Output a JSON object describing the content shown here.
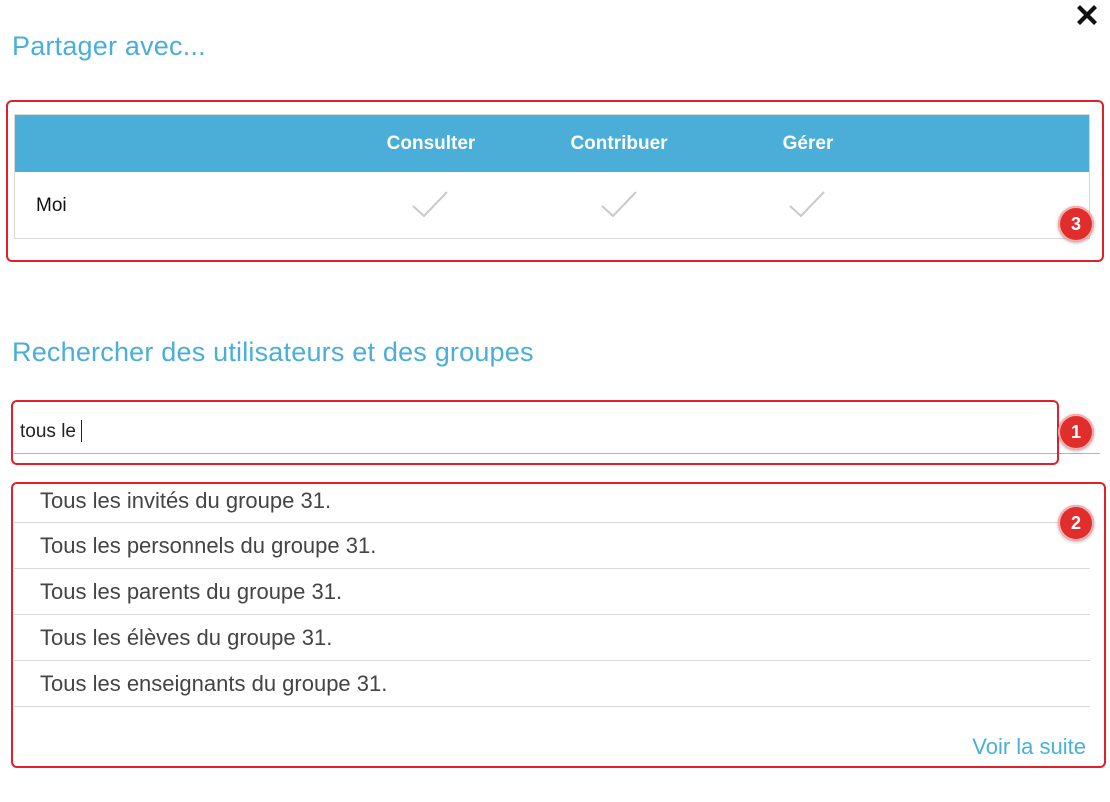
{
  "dialog": {
    "close_icon": "close-icon"
  },
  "share": {
    "title": "Partager avec...",
    "columns": [
      "Consulter",
      "Contribuer",
      "Gérer"
    ],
    "rows": [
      {
        "label": "Moi",
        "consult": true,
        "contribute": true,
        "manage": true
      }
    ]
  },
  "search": {
    "title": "Rechercher des utilisateurs et des groupes",
    "input_value": "tous le",
    "results": [
      "Tous les invités du groupe 31.",
      "Tous les personnels du groupe 31.",
      "Tous les parents du groupe 31.",
      "Tous les élèves du groupe 31.",
      "Tous les enseignants du groupe 31."
    ],
    "see_more": "Voir la suite"
  },
  "annotations": {
    "badge_1": "1",
    "badge_2": "2",
    "badge_3": "3"
  },
  "colors": {
    "accent": "#4aaed9",
    "annotation": "#e0212a",
    "input_underline": "#e8a868"
  }
}
